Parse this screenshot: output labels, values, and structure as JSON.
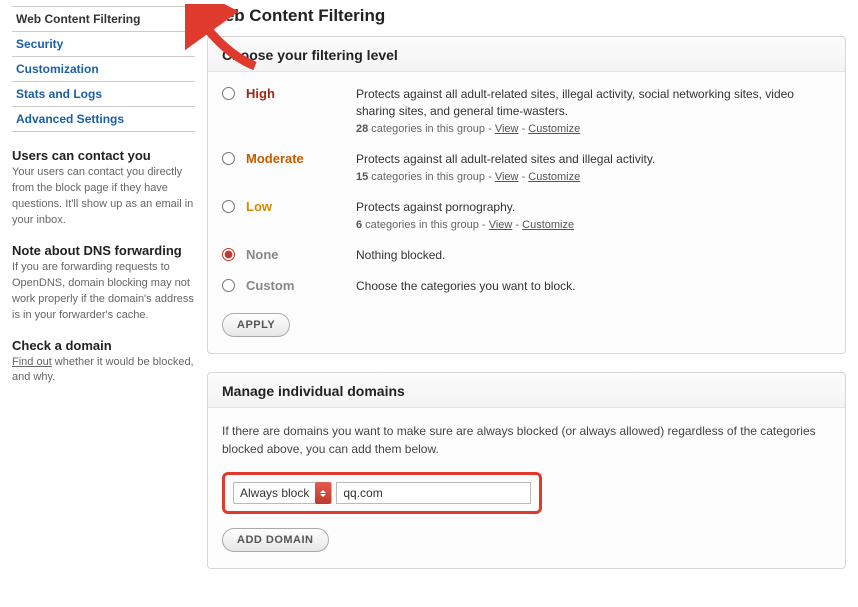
{
  "sidebar": {
    "nav": [
      {
        "label": "Web Content Filtering",
        "active": true
      },
      {
        "label": "Security",
        "active": false
      },
      {
        "label": "Customization",
        "active": false
      },
      {
        "label": "Stats and Logs",
        "active": false
      },
      {
        "label": "Advanced Settings",
        "active": false
      }
    ],
    "blocks": {
      "contact": {
        "title": "Users can contact you",
        "body": "Your users can contact you directly from the block page if they have questions. It'll show up as an email in your inbox."
      },
      "dns": {
        "title": "Note about DNS forwarding",
        "body": "If you are forwarding requests to OpenDNS, domain blocking may not work properly if the domain's address is in your forwarder's cache."
      },
      "check": {
        "title": "Check a domain",
        "link": "Find out",
        "rest": " whether it would be blocked, and why."
      }
    }
  },
  "page": {
    "title": "Web Content Filtering"
  },
  "filter": {
    "heading": "Choose your filtering level",
    "levels": {
      "high": {
        "label": "High",
        "desc": "Protects against all adult-related sites, illegal activity, social networking sites, video sharing sites, and general time-wasters.",
        "count": "28",
        "cats_text": " categories in this group - ",
        "view": "View",
        "sep": " - ",
        "cust": "Customize"
      },
      "moderate": {
        "label": "Moderate",
        "desc": "Protects against all adult-related sites and illegal activity.",
        "count": "15",
        "cats_text": " categories in this group - ",
        "view": "View",
        "sep": " - ",
        "cust": "Customize"
      },
      "low": {
        "label": "Low",
        "desc": "Protects against pornography.",
        "count": "6",
        "cats_text": " categories in this group - ",
        "view": "View",
        "sep": " - ",
        "cust": "Customize"
      },
      "none": {
        "label": "None",
        "desc": "Nothing blocked."
      },
      "custom": {
        "label": "Custom",
        "desc": "Choose the categories you want to block."
      }
    },
    "apply": "APPLY",
    "selected": "none"
  },
  "manage": {
    "heading": "Manage individual domains",
    "desc": "If there are domains you want to make sure are always blocked (or always allowed) regardless of the categories blocked above, you can add them below.",
    "action_select": "Always block",
    "domain_value": "qq.com",
    "add_button": "ADD DOMAIN"
  }
}
